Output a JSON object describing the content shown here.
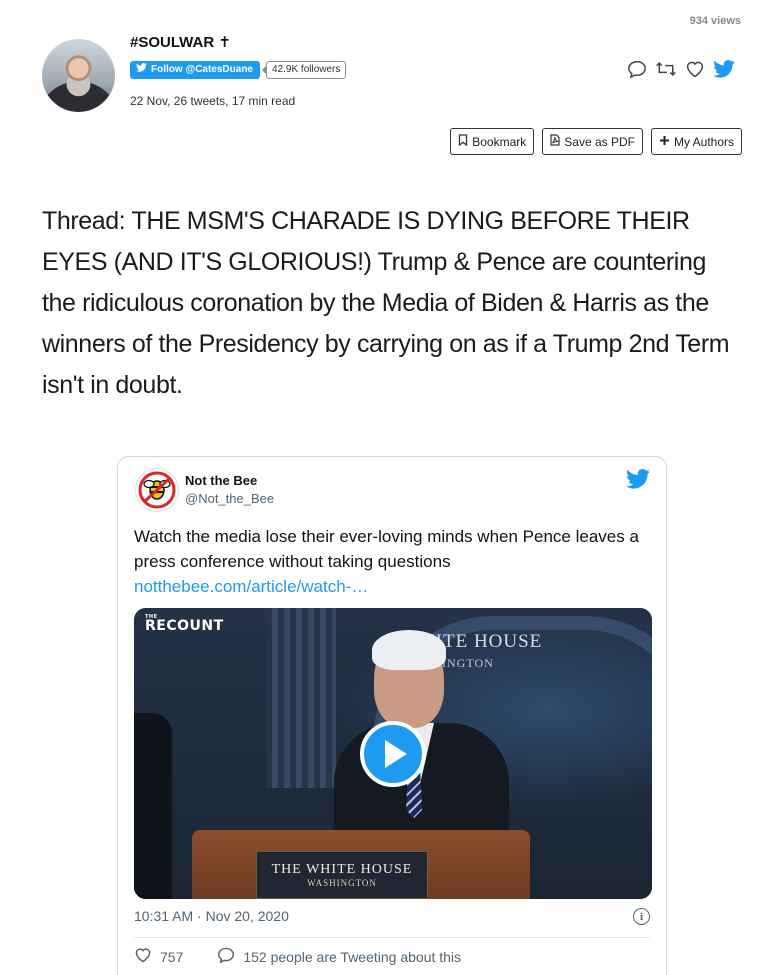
{
  "header": {
    "views": "934 views",
    "author_name": "#SOULWAR ✝",
    "follow_label": "Follow @CatesDuane",
    "followers": "42.9K followers",
    "meta": "22 Nov, 26 tweets, 17 min read"
  },
  "toolbar": {
    "bookmark_label": "Bookmark",
    "save_pdf_label": "Save as PDF",
    "my_authors_label": "My Authors"
  },
  "thread": {
    "text": "Thread: THE MSM'S CHARADE IS DYING BEFORE THEIR EYES (AND IT'S GLORIOUS!) Trump & Pence are countering the ridiculous coronation by the Media of Biden & Harris as the winners of the Presidency by carrying on as if a Trump 2nd Term isn't in doubt."
  },
  "embedded_tweet": {
    "name": "Not the Bee",
    "handle": "@Not_the_Bee",
    "text": "Watch the media lose their ever-loving minds when Pence leaves a press conference without taking questions",
    "link": "notthebee.com/article/watch-…",
    "video": {
      "brand_small": "THE",
      "brand": "RECOUNT",
      "wall_title": "WHITE HOUSE",
      "wall_subtitle": "WASHINGTON",
      "podium_title": "THE WHITE HOUSE",
      "podium_subtitle": "WASHINGTON"
    },
    "timestamp": "10:31 AM · Nov 20, 2020",
    "likes": "757",
    "replies_text": "152 people are Tweeting about this"
  },
  "colors": {
    "twitter_blue": "#1d9bf0",
    "muted_text": "#536471"
  }
}
